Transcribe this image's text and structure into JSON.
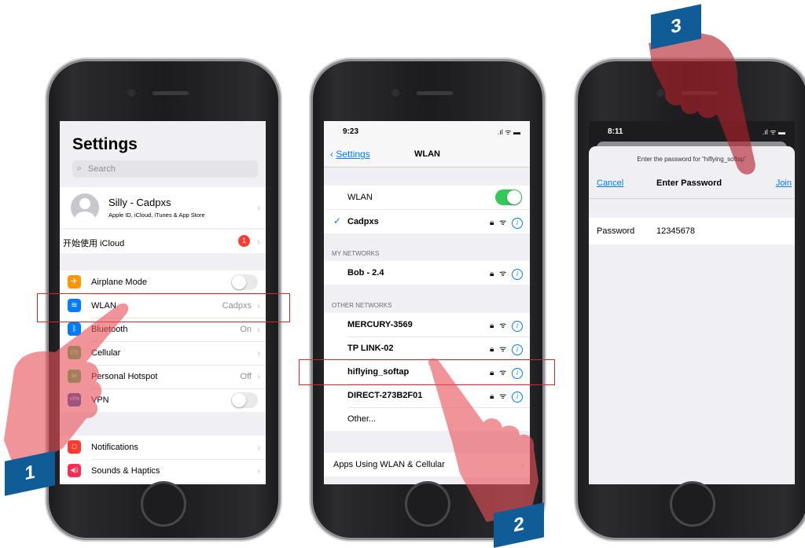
{
  "phone1": {
    "title": "Settings",
    "search_placeholder": "Search",
    "profile_name": "Silly - Cadpxs",
    "profile_sub": "Apple ID, iCloud, iTunes & App Store",
    "icloud_label": "开始使用 iCloud",
    "icloud_badge": "1",
    "rows": [
      {
        "label": "Airplane Mode",
        "value": "",
        "icon": "airplane-icon",
        "color": "#ff9500",
        "glyph": "✈",
        "toggle": true
      },
      {
        "label": "WLAN",
        "value": "Cadpxs",
        "icon": "wifi-icon",
        "color": "#007aff",
        "glyph": "≋",
        "toggle": false
      },
      {
        "label": "Bluetooth",
        "value": "On",
        "icon": "bluetooth-icon",
        "color": "#007aff",
        "glyph": "ᛒ",
        "toggle": false
      },
      {
        "label": "Cellular",
        "value": "",
        "icon": "cellular-icon",
        "color": "#34c759",
        "glyph": "((•))",
        "toggle": false
      },
      {
        "label": "Personal Hotspot",
        "value": "Off",
        "icon": "hotspot-icon",
        "color": "#34c759",
        "glyph": "∞",
        "toggle": false
      },
      {
        "label": "VPN",
        "value": "",
        "icon": "vpn-icon",
        "color": "#2c54b8",
        "glyph": "VPN",
        "toggle": true
      }
    ],
    "rows2": [
      {
        "label": "Notifications",
        "icon": "notifications-icon",
        "color": "#ff3b30",
        "glyph": "▢"
      },
      {
        "label": "Sounds & Haptics",
        "icon": "sounds-icon",
        "color": "#ff2d55",
        "glyph": "◀))"
      }
    ],
    "step": "1"
  },
  "phone2": {
    "time": "9:23",
    "back_label": "Settings",
    "nav_title": "WLAN",
    "wlan_label": "WLAN",
    "connected": "Cadpxs",
    "my_networks_header": "MY NETWORKS",
    "my_networks": [
      "Bob - 2.4"
    ],
    "other_networks_header": "OTHER NETWORKS",
    "other_networks": [
      "MERCURY-3569",
      "TP LINK-02",
      "hiflying_softap",
      "DIRECT-273B2F01",
      "Other..."
    ],
    "apps_row": "Apps Using WLAN & Cellular",
    "step": "2"
  },
  "phone3": {
    "time": "8:11",
    "prompt": "Enter the password for “hiflying_softap”",
    "cancel": "Cancel",
    "title": "Enter Password",
    "join": "Join",
    "password_label": "Password",
    "password_value": "12345678",
    "step": "3"
  },
  "colors": {
    "accent": "#007aff",
    "step_badge": "#0f5c96",
    "highlight": "#d7262e"
  }
}
